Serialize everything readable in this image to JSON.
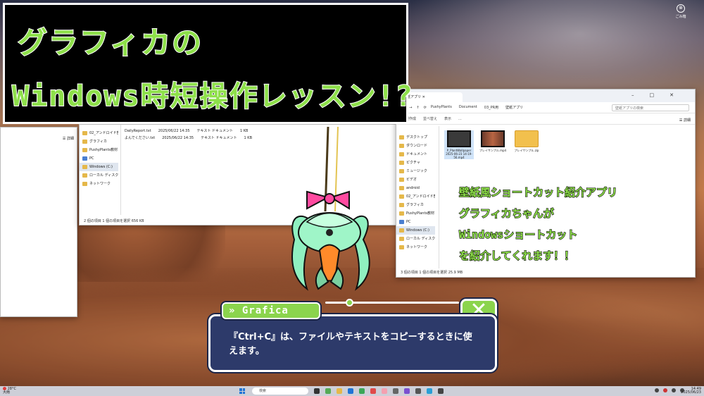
{
  "banner": {
    "line1": "グラフィカの",
    "line2": "Windows時短操作レッスン!?"
  },
  "desktop": {
    "top_right_caption": "ごみ箱"
  },
  "explorer_left": {
    "view_label": "詳細"
  },
  "explorer_mid": {
    "sidebar": [
      "02_アンドロイド部",
      "グラフィカ",
      "PushyPlants教材",
      "PC",
      "Windows (C:)",
      "ローカル ディスク",
      "ネットワーク"
    ],
    "files": [
      {
        "name": "DailyReport.txt",
        "date": "2025/06/22 14:35",
        "type": "テキスト ドキュメント",
        "size": "1 KB"
      },
      {
        "name": "よんでください.txt",
        "date": "2025/06/22 14:35",
        "type": "テキスト ドキュメント",
        "size": "1 KB"
      }
    ],
    "status": "2 個の項目   1 個の項目を選択  656 KB"
  },
  "explorer_right": {
    "tab_title": "壁紙アプリ",
    "path": [
      "PushyPlants",
      "Document",
      "03_PR用",
      "壁紙アプリ"
    ],
    "search_placeholder": "壁紙アプリの検索",
    "tools": [
      "新規作成",
      "並べ替え",
      "表示",
      "..."
    ],
    "view_label": "詳細",
    "sidebar": [
      "デスクトップ",
      "ダウンロード",
      "ドキュメント",
      "ピクチャ",
      "ミュージック",
      "ビデオ",
      "android",
      "02_アンドロイド部",
      "グラフィカ",
      "PushyPlants教材",
      "PC",
      "Windows (C:)",
      "ローカル ディスク",
      "ネットワーク"
    ],
    "files": [
      {
        "name": "P_PlantWallpaper 2025-06-23 14-19-56.mp4",
        "kind": "video"
      },
      {
        "name": "プレイサンプル.mp4",
        "kind": "video2"
      },
      {
        "name": "プレイサンプル.zip",
        "kind": "zip"
      }
    ],
    "status": "3 個の項目  1 個の項目を選択  25.9 MB"
  },
  "caption": {
    "lines": [
      "壁紙風ショートカット紹介アプリ",
      "グラフィカちゃんが",
      "Windowsショートカット",
      "を紹介してくれます！！"
    ]
  },
  "dialog": {
    "speaker": "» Grafica",
    "message": "『Ctrl+C』は、ファイルやテキストをコピーするときに使えます。",
    "close_label": "✕",
    "progress": 0.18
  },
  "taskbar": {
    "weather_temp": "28°C",
    "weather_label": "大雨",
    "search_placeholder": "検索",
    "time": "14:49",
    "date": "2025/06/23"
  },
  "colors": {
    "accent_green": "#8bd44d",
    "dialog_bg": "#2d3a6a"
  }
}
